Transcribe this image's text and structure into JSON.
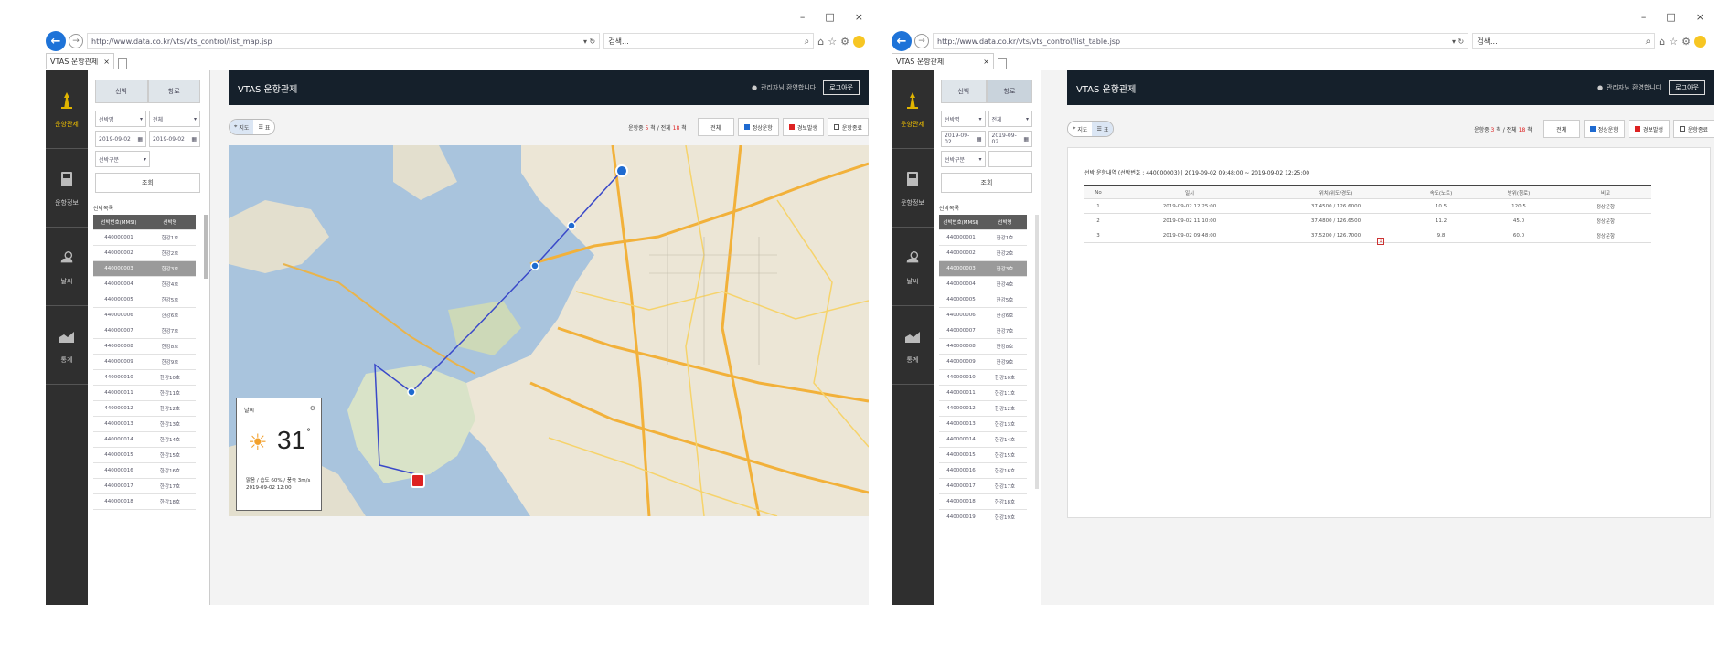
{
  "left_window": {
    "window_controls": [
      "–",
      "□",
      "×"
    ],
    "address": "http://www.data.co.kr/vts/vts_control/list_map.jsp",
    "search_text": "검색...",
    "tab_title": "VTAS 운항관제",
    "sidebar": [
      {
        "label": "운항관제",
        "active": true,
        "icon": "tower-icon"
      },
      {
        "label": "운항정보",
        "active": false,
        "icon": "ship-icon"
      },
      {
        "label": "날씨",
        "active": false,
        "icon": "weather-icon"
      },
      {
        "label": "통계",
        "active": false,
        "icon": "chart-icon"
      }
    ],
    "panel_tabs": [
      "선박",
      "항로"
    ],
    "filter_row1": [
      "선박명",
      "전체"
    ],
    "filter_row2": [
      "2019-09-02",
      "2019-09-02"
    ],
    "filter_row3": [
      "선박구분"
    ],
    "query_label": "조회",
    "list_label": "선박목록",
    "list_headers": [
      "선박번호(MMSI)",
      "선박명"
    ],
    "list_rows": [
      [
        "440000001",
        "한강1호"
      ],
      [
        "440000002",
        "한강2호"
      ],
      [
        "440000003",
        "한강3호"
      ],
      [
        "440000004",
        "한강4호"
      ],
      [
        "440000005",
        "한강5호"
      ],
      [
        "440000006",
        "한강6호"
      ],
      [
        "440000007",
        "한강7호"
      ],
      [
        "440000008",
        "한강8호"
      ],
      [
        "440000009",
        "한강9호"
      ],
      [
        "440000010",
        "한강10호"
      ],
      [
        "440000011",
        "한강11호"
      ],
      [
        "440000012",
        "한강12호"
      ],
      [
        "440000013",
        "한강13호"
      ],
      [
        "440000014",
        "한강14호"
      ],
      [
        "440000015",
        "한강15호"
      ],
      [
        "440000016",
        "한강16호"
      ],
      [
        "440000017",
        "한강17호"
      ],
      [
        "440000018",
        "한강18호"
      ]
    ],
    "selected_row": 2,
    "header_title": "VTAS 운항관제",
    "user_name": "관리자님 환영합니다",
    "logout": "로그아웃",
    "view_toggle": [
      "지도",
      "표"
    ],
    "view_active": 0,
    "info_prefix": "운항중",
    "info_count": "5",
    "info_mid": "척 / 전체",
    "info_total": "18",
    "info_suffix": "척",
    "buttons": [
      {
        "label": "전체",
        "color": ""
      },
      {
        "label": "정상운항",
        "color": "#1e6ad0"
      },
      {
        "label": "경보발생",
        "color": "#d22"
      },
      {
        "label": "운항종료",
        "color": "#555"
      }
    ],
    "map_label": "지도 데이터",
    "weather": {
      "title": "날씨",
      "temp": "31",
      "deg": "°",
      "desc1": "맑음 / 습도 60% / 풍속 3m/s",
      "desc2": "2019-09-02 12:00"
    }
  },
  "right_window": {
    "window_controls": [
      "–",
      "□",
      "×"
    ],
    "address": "http://www.data.co.kr/vts/vts_control/list_table.jsp",
    "search_text": "검색...",
    "tab_title": "VTAS 운항관제",
    "sidebar": [
      {
        "label": "운항관제",
        "active": true,
        "icon": "tower-icon"
      },
      {
        "label": "운항정보",
        "active": false,
        "icon": "ship-icon"
      },
      {
        "label": "날씨",
        "active": false,
        "icon": "weather-icon"
      },
      {
        "label": "통계",
        "active": false,
        "icon": "chart-icon"
      }
    ],
    "panel_tabs": [
      "선박",
      "항로"
    ],
    "filter_row1": [
      "선박명",
      "전체"
    ],
    "filter_row2": [
      "2019-09-02",
      "2019-09-02"
    ],
    "filter_row3": [
      "선박구분"
    ],
    "query_label": "조회",
    "list_label": "선박목록",
    "list_headers": [
      "선박번호(MMSI)",
      "선박명"
    ],
    "list_rows": [
      [
        "440000001",
        "한강1호"
      ],
      [
        "440000002",
        "한강2호"
      ],
      [
        "440000003",
        "한강3호"
      ],
      [
        "440000004",
        "한강4호"
      ],
      [
        "440000005",
        "한강5호"
      ],
      [
        "440000006",
        "한강6호"
      ],
      [
        "440000007",
        "한강7호"
      ],
      [
        "440000008",
        "한강8호"
      ],
      [
        "440000009",
        "한강9호"
      ],
      [
        "440000010",
        "한강10호"
      ],
      [
        "440000011",
        "한강11호"
      ],
      [
        "440000012",
        "한강12호"
      ],
      [
        "440000013",
        "한강13호"
      ],
      [
        "440000014",
        "한강14호"
      ],
      [
        "440000015",
        "한강15호"
      ],
      [
        "440000016",
        "한강16호"
      ],
      [
        "440000017",
        "한강17호"
      ],
      [
        "440000018",
        "한강18호"
      ],
      [
        "440000019",
        "한강19호"
      ]
    ],
    "selected_row": 2,
    "header_title": "VTAS 운항관제",
    "user_name": "관리자님 환영합니다",
    "logout": "로그아웃",
    "view_toggle": [
      "지도",
      "표"
    ],
    "view_active": 1,
    "info_prefix": "운항중",
    "info_count": "3",
    "info_mid": "척 / 전체",
    "info_total": "18",
    "info_suffix": "척",
    "buttons": [
      {
        "label": "전체",
        "color": ""
      },
      {
        "label": "정상운항",
        "color": "#1e6ad0"
      },
      {
        "label": "경보발생",
        "color": "#d22"
      },
      {
        "label": "운항종료",
        "color": "#555"
      }
    ],
    "summary": "선박 운항내역 (선박번호 : 440000003) | 2019-09-02 09:48:00 ~ 2019-09-02 12:25:00",
    "result_headers": [
      "No",
      "일시",
      "위치(위도/경도)",
      "속도(노트)",
      "방위(침로)",
      "비고"
    ],
    "result_rows": [
      [
        "1",
        "2019-09-02 12:25:00",
        "37.4500 / 126.6000",
        "10.5",
        "120.5",
        "정상운항"
      ],
      [
        "2",
        "2019-09-02 11:10:00",
        "37.4800 / 126.6500",
        "11.2",
        "45.0",
        "정상운항"
      ],
      [
        "3",
        "2019-09-02 09:48:00",
        "37.5200 / 126.7000",
        "9.8",
        "60.0",
        "정상운항"
      ]
    ],
    "page": "1"
  }
}
